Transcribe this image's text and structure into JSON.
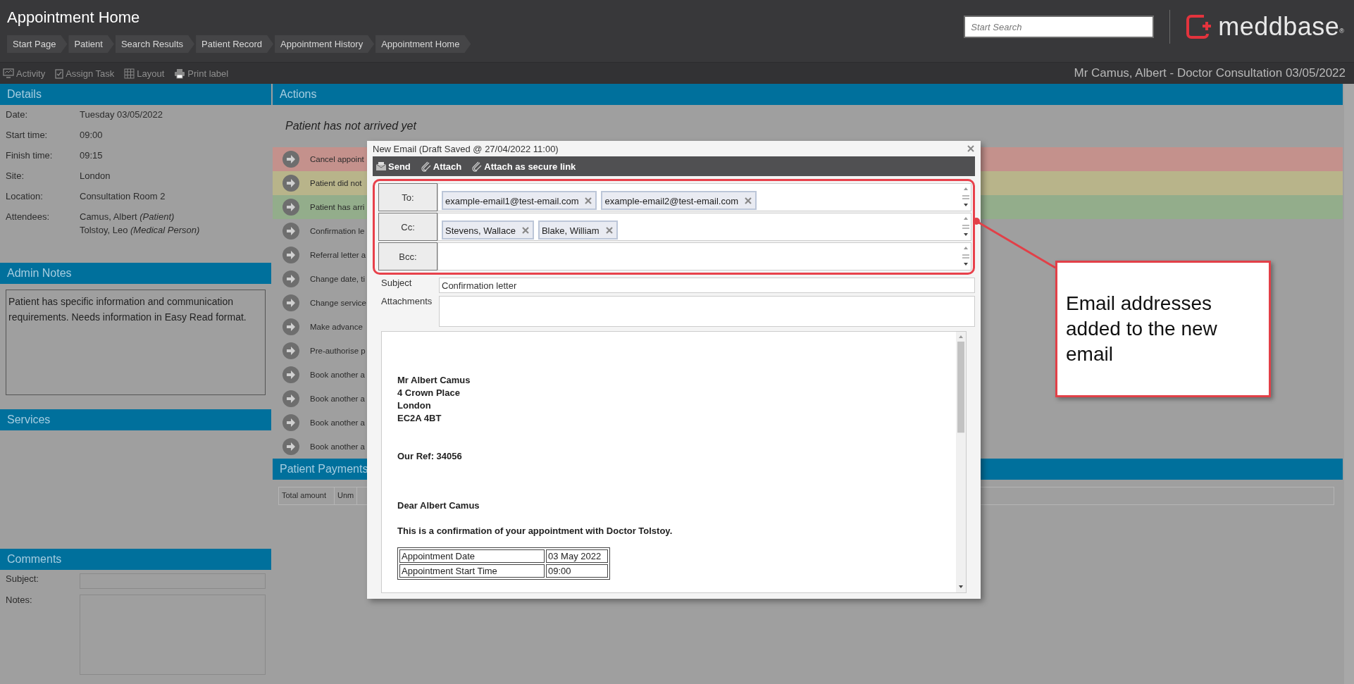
{
  "header": {
    "title": "Appointment Home",
    "breadcrumbs": [
      "Start Page",
      "Patient",
      "Search Results",
      "Patient Record",
      "Appointment History",
      "Appointment Home"
    ],
    "search": {
      "placeholder": "Start Search"
    },
    "logo": {
      "text": "meddbase",
      "mark": "®"
    }
  },
  "toolbar": {
    "items": [
      {
        "label": "Activity",
        "kind": "monitor"
      },
      {
        "label": "Assign Task",
        "kind": "clipboard"
      },
      {
        "label": "Layout",
        "kind": "grid"
      },
      {
        "label": "Print label",
        "kind": "printer"
      }
    ],
    "context": "Mr Camus, Albert - Doctor Consultation 03/05/2022"
  },
  "details": {
    "title": "Details",
    "fields": [
      {
        "label": "Date:",
        "values": [
          "Tuesday 03/05/2022"
        ]
      },
      {
        "label": "Start time:",
        "values": [
          "09:00"
        ]
      },
      {
        "label": "Finish time:",
        "values": [
          "09:15"
        ]
      },
      {
        "label": "Site:",
        "values": [
          "London"
        ]
      },
      {
        "label": "Location:",
        "values": [
          "Consultation Room 2"
        ]
      },
      {
        "label": "Attendees:",
        "values": [
          "Camus, Albert *(Patient)*",
          "Tolstoy, Leo *(Medical Person)*"
        ]
      }
    ]
  },
  "admin_notes": {
    "title": "Admin Notes",
    "text": "Patient has specific information and communication requirements. Needs information in Easy Read format."
  },
  "services": {
    "title": "Services"
  },
  "comments": {
    "title": "Comments",
    "fields": [
      {
        "label": "Subject:",
        "kind": "line"
      },
      {
        "label": "Notes:",
        "kind": "area"
      }
    ]
  },
  "actions": {
    "title": "Actions",
    "status": "Patient has not arrived yet",
    "items": [
      {
        "label": "Cancel appoint",
        "color": "#c4918c"
      },
      {
        "label": "Patient did not",
        "color": "#b8b48a"
      },
      {
        "label": "Patient has arri",
        "color": "#93ad8b"
      },
      {
        "label": "Confirmation le"
      },
      {
        "label": "Referral letter a"
      },
      {
        "label": "Change date, ti"
      },
      {
        "label": "Change service"
      },
      {
        "label": "Make advance"
      },
      {
        "label": "Pre-authorise p"
      },
      {
        "label": "Book another a"
      },
      {
        "label": "Book another a"
      },
      {
        "label": "Book another a"
      },
      {
        "label": "Book another a"
      }
    ]
  },
  "payments": {
    "title": "Patient Payments",
    "columns": [
      "Total amount",
      "Unm"
    ]
  },
  "dialog": {
    "title": "New Email (Draft Saved @ 27/04/2022 11:00)",
    "toolbar": [
      {
        "label": "Send",
        "kind": "envelope"
      },
      {
        "label": "Attach",
        "kind": "paperclip"
      },
      {
        "label": "Attach as secure link",
        "kind": "paperclip"
      }
    ],
    "recipients": [
      {
        "label": "To:",
        "chips": [
          "example-email1@test-email.com",
          "example-email2@test-email.com"
        ]
      },
      {
        "label": "Cc:",
        "chips": [
          "Stevens, Wallace",
          "Blake, William"
        ]
      },
      {
        "label": "Bcc:"
      }
    ],
    "subject": {
      "label": "Subject",
      "value": "Confirmation letter"
    },
    "attachments": {
      "label": "Attachments"
    },
    "body": {
      "address": [
        "Mr Albert Camus",
        "4 Crown Place",
        "London",
        "EC2A 4BT"
      ],
      "ref": "Our Ref: 34056",
      "greeting": "Dear Albert Camus",
      "intro": "This is a confirmation of your appointment with Doctor Tolstoy.",
      "table": [
        [
          "Appointment Date",
          "03 May 2022"
        ],
        [
          "Appointment Start Time",
          "09:00"
        ]
      ]
    }
  },
  "annotation": {
    "text": "Email addresses added to the new email"
  }
}
